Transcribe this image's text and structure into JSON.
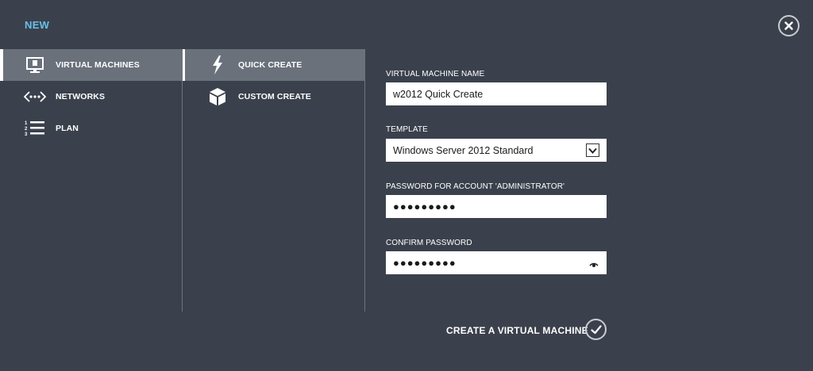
{
  "header": {
    "title": "NEW"
  },
  "categories": [
    {
      "label": "VIRTUAL MACHINES",
      "icon": "monitor-icon",
      "selected": true
    },
    {
      "label": "NETWORKS",
      "icon": "network-icon",
      "selected": false
    },
    {
      "label": "PLAN",
      "icon": "numbered-list-icon",
      "selected": false
    }
  ],
  "options": [
    {
      "label": "QUICK CREATE",
      "icon": "lightning-icon",
      "selected": true
    },
    {
      "label": "CUSTOM CREATE",
      "icon": "box-icon",
      "selected": false
    }
  ],
  "form": {
    "vm_name": {
      "label": "VIRTUAL MACHINE NAME",
      "value": "w2012 Quick Create"
    },
    "template": {
      "label": "TEMPLATE",
      "value": "Windows Server 2012 Standard"
    },
    "password": {
      "label": "PASSWORD FOR ACCOUNT 'ADMINISTRATOR'",
      "value": "●●●●●●●●●"
    },
    "confirm_password": {
      "label": "CONFIRM PASSWORD",
      "value": "●●●●●●●●●"
    }
  },
  "footer": {
    "create_label": "CREATE A VIRTUAL MACHINE"
  },
  "colors": {
    "background": "#3b414c",
    "accent": "#67c1ea",
    "selected": "#6b717b"
  }
}
